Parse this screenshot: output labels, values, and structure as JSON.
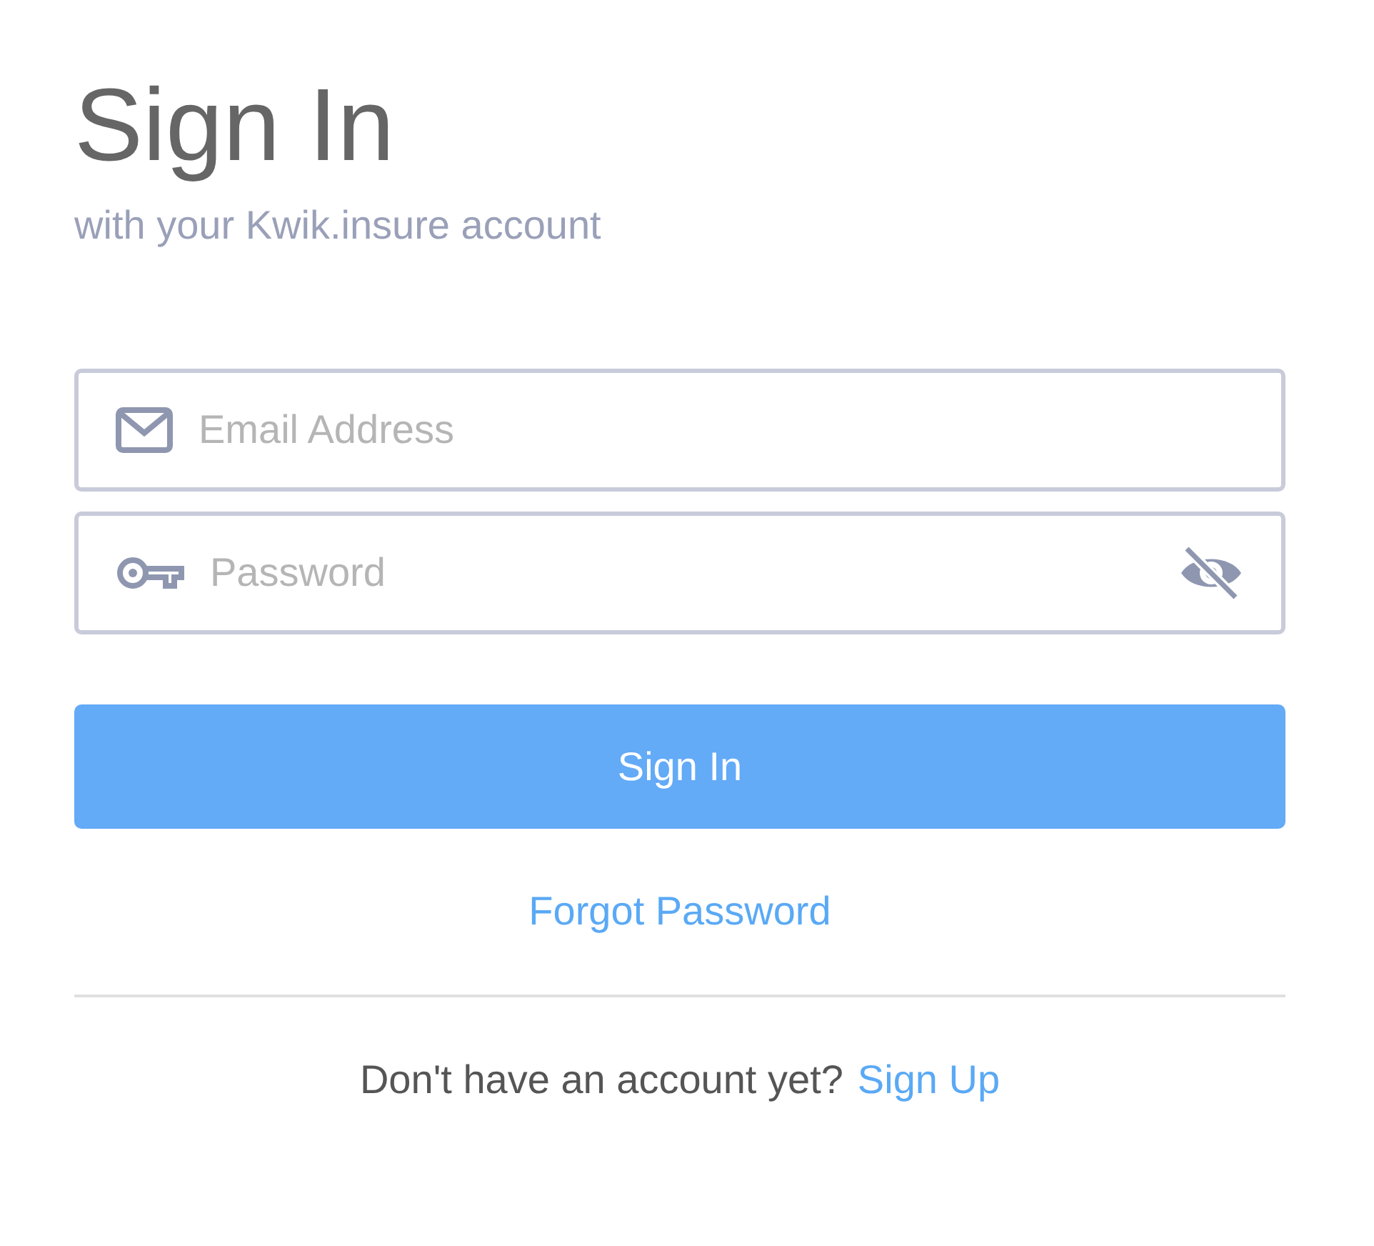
{
  "title": "Sign In",
  "subtitle": "with your Kwik.insure account",
  "email_field": {
    "placeholder": "Email Address"
  },
  "password_field": {
    "placeholder": "Password",
    "show_password": false
  },
  "submit_button": "Sign In",
  "forgot_link": "Forgot Password",
  "signup": {
    "prompt": "Don't have an account yet?",
    "link": "Sign Up"
  }
}
